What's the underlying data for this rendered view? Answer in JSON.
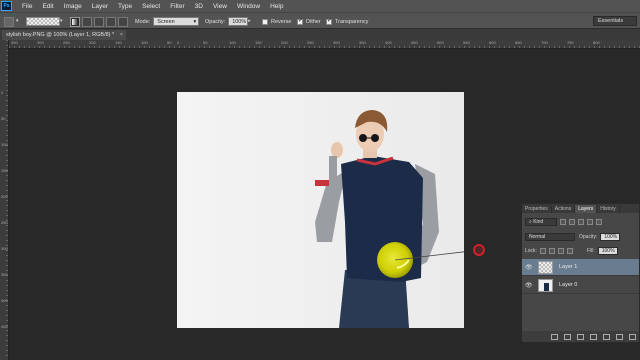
{
  "menu": {
    "logo": "Ps",
    "items": [
      "File",
      "Edit",
      "Image",
      "Layer",
      "Type",
      "Select",
      "Filter",
      "3D",
      "View",
      "Window",
      "Help"
    ]
  },
  "options": {
    "mode_label": "Mode:",
    "mode_value": "Screen",
    "opacity_label": "Opacity:",
    "opacity_value": "100%",
    "reverse_label": "Reverse",
    "reverse_checked": false,
    "dither_label": "Dither",
    "dither_checked": true,
    "transparency_label": "Transparency",
    "transparency_checked": true,
    "workspace": "Essentials"
  },
  "document": {
    "tab_title": "stylish boy.PNG @ 100% (Layer 1, RGB/8) *",
    "close": "×"
  },
  "rulers": {
    "top": [
      "350",
      "300",
      "250",
      "200",
      "150",
      "100",
      "50",
      "0",
      "50",
      "100",
      "150",
      "200",
      "250",
      "300",
      "350",
      "400",
      "450",
      "500",
      "550",
      "600",
      "650",
      "700",
      "750",
      "800"
    ],
    "left": [
      "0",
      "50",
      "100",
      "150",
      "200",
      "250",
      "300",
      "350",
      "400",
      "450"
    ]
  },
  "colors": {
    "flare": "#e6e400",
    "endpoint": "#d0202a",
    "jacket": "#1c2b47",
    "sleeve": "#9a9ea3"
  },
  "layers_panel": {
    "tabs": [
      "Properties",
      "Actions",
      "Layers",
      "History"
    ],
    "active_tab": "Layers",
    "filter_kind": "Kind",
    "blend_mode": "Normal",
    "opacity_label": "Opacity:",
    "opacity_value": "100%",
    "lock_label": "Lock:",
    "fill_label": "Fill:",
    "fill_value": "100%",
    "layers": [
      {
        "name": "Layer 1",
        "selected": true
      },
      {
        "name": "Layer 0",
        "selected": false
      }
    ]
  }
}
